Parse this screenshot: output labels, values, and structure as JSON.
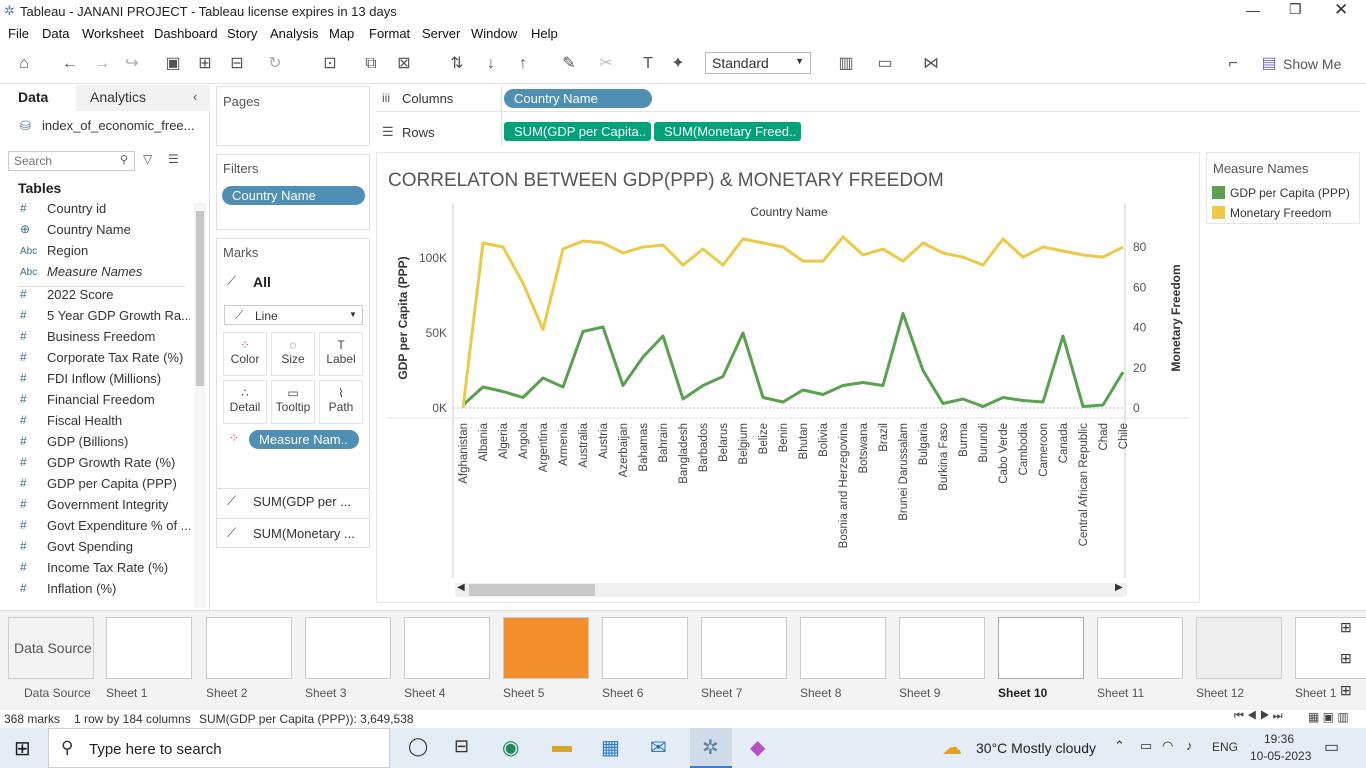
{
  "window": {
    "title": "Tableau - JANANI PROJECT - Tableau license expires in 13 days"
  },
  "menu": [
    "File",
    "Data",
    "Worksheet",
    "Dashboard",
    "Story",
    "Analysis",
    "Map",
    "Format",
    "Server",
    "Window",
    "Help"
  ],
  "toolbar": {
    "fit": "Standard",
    "show_me": "Show Me"
  },
  "left": {
    "tab_data": "Data",
    "tab_analytics": "Analytics",
    "datasource": "index_of_economic_free...",
    "search_placeholder": "Search",
    "tables_label": "Tables",
    "fields": [
      {
        "icon": "#",
        "name": "Country id"
      },
      {
        "icon": "⊕",
        "name": "Country Name"
      },
      {
        "icon": "Abc",
        "name": "Region"
      },
      {
        "icon": "Abc",
        "name": "Measure Names"
      },
      {
        "icon": "#",
        "name": "2022 Score"
      },
      {
        "icon": "#",
        "name": "5 Year GDP Growth Ra..."
      },
      {
        "icon": "#",
        "name": "Business Freedom"
      },
      {
        "icon": "#",
        "name": "Corporate Tax Rate (%)"
      },
      {
        "icon": "#",
        "name": "FDI Inflow (Millions)"
      },
      {
        "icon": "#",
        "name": "Financial Freedom"
      },
      {
        "icon": "#",
        "name": "Fiscal Health"
      },
      {
        "icon": "#",
        "name": "GDP (Billions)"
      },
      {
        "icon": "#",
        "name": "GDP Growth Rate (%)"
      },
      {
        "icon": "#",
        "name": "GDP per Capita (PPP)"
      },
      {
        "icon": "#",
        "name": "Government Integrity"
      },
      {
        "icon": "#",
        "name": "Govt Expenditure % of ..."
      },
      {
        "icon": "#",
        "name": "Govt Spending"
      },
      {
        "icon": "#",
        "name": "Income Tax Rate (%)"
      },
      {
        "icon": "#",
        "name": "Inflation (%)"
      }
    ]
  },
  "shelves": {
    "pages": "Pages",
    "filters": "Filters",
    "filter_pill": "Country Name",
    "marks": "Marks",
    "marks_all": "All",
    "mark_type": "Line",
    "mark_buttons": [
      "Color",
      "Size",
      "Label",
      "Detail",
      "Tooltip",
      "Path"
    ],
    "measure_pill": "Measure Nam..",
    "sum1": "SUM(GDP per ...",
    "sum2": "SUM(Monetary ...",
    "columns_label": "Columns",
    "columns_pill": "Country Name",
    "rows_label": "Rows",
    "rows_pill1": "SUM(GDP per Capita..",
    "rows_pill2": "SUM(Monetary Freed.."
  },
  "legend": {
    "title": "Measure Names",
    "items": [
      {
        "name": "GDP per Capita (PPP)",
        "color": "#59a14f"
      },
      {
        "name": "Monetary Freedom",
        "color": "#edc948"
      }
    ]
  },
  "chart_data": {
    "type": "line",
    "title": "CORRELATON BETWEEN GDP(PPP) & MONETARY FREEDOM",
    "header": "Country Name",
    "ylabel_left": "GDP per Capita (PPP)",
    "ylabel_right": "Monetary Freedom",
    "yticks_left": [
      "0K",
      "50K",
      "100K"
    ],
    "yticks_right": [
      "0",
      "20",
      "40",
      "60",
      "80"
    ],
    "ylim_left": [
      0,
      120000
    ],
    "ylim_right": [
      0,
      90
    ],
    "categories": [
      "Afghanistan",
      "Albania",
      "Algeria",
      "Angola",
      "Argentina",
      "Armenia",
      "Australia",
      "Austria",
      "Azerbaijan",
      "Bahamas",
      "Bahrain",
      "Bangladesh",
      "Barbados",
      "Belarus",
      "Belgium",
      "Belize",
      "Benin",
      "Bhutan",
      "Bolivia",
      "Bosnia and Herzegovina",
      "Botswana",
      "Brazil",
      "Brunei Darussalam",
      "Bulgaria",
      "Burkina Faso",
      "Burma",
      "Burundi",
      "Cabo Verde",
      "Cambodia",
      "Cameroon",
      "Canada",
      "Central African Republic",
      "Chad",
      "Chile"
    ],
    "series": [
      {
        "name": "GDP per Capita (PPP)",
        "color": "#59a14f",
        "values": [
          2000,
          14000,
          11000,
          7000,
          20000,
          14000,
          51000,
          54000,
          15000,
          34000,
          48000,
          6000,
          15000,
          21000,
          50000,
          7000,
          4000,
          12000,
          9000,
          15000,
          17000,
          15000,
          63000,
          25000,
          3000,
          6000,
          1000,
          7000,
          5000,
          4000,
          48000,
          1000,
          2000,
          24000
        ]
      },
      {
        "name": "Monetary Freedom",
        "color": "#edc948",
        "values": [
          0,
          82,
          80,
          62,
          39,
          79,
          83,
          82,
          77,
          80,
          81,
          71,
          79,
          71,
          84,
          82,
          80,
          73,
          73,
          85,
          76,
          79,
          73,
          82,
          77,
          75,
          71,
          84,
          75,
          80,
          78,
          76,
          75,
          80
        ]
      }
    ]
  },
  "sheet_tabs": [
    "Data Source",
    "Sheet 1",
    "Sheet 2",
    "Sheet 3",
    "Sheet 4",
    "Sheet 5",
    "Sheet 6",
    "Sheet 7",
    "Sheet 8",
    "Sheet 9",
    "Sheet 10",
    "Sheet 11",
    "Sheet 12",
    "Sheet 1"
  ],
  "status": {
    "marks": "368 marks",
    "dims": "1 row by 184 columns",
    "sum": "SUM(GDP per Capita (PPP)): 3,649,538"
  },
  "taskbar": {
    "search": "Type here to search",
    "weather": "30°C  Mostly cloudy",
    "lang": "ENG",
    "time": "19:36",
    "date": "10-05-2023"
  }
}
